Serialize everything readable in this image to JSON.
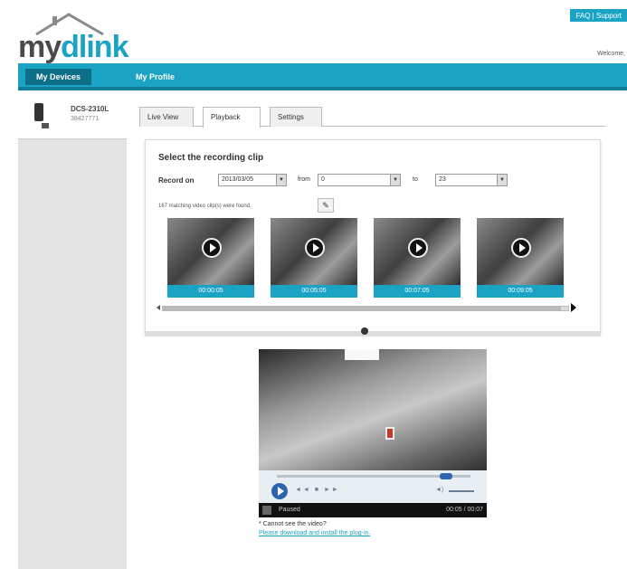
{
  "header": {
    "logo_my": "my",
    "logo_dlink": "dlink",
    "faq_label": "FAQ | Support",
    "welcome": "Welcome,"
  },
  "nav": {
    "devices_label": "My Devices",
    "profile_label": "My Profile"
  },
  "sidebar": {
    "device_name": "DCS-2310L",
    "device_sub": "38427771"
  },
  "tabs": [
    "Live View",
    "Playback",
    "Settings"
  ],
  "clip_panel": {
    "title": "Select the recording clip",
    "recorded_on_label": "Record on",
    "recorded_on_value": "2013/03/05",
    "from_label": "from",
    "from_value": "0",
    "to_label": "to",
    "to_value": "23",
    "matching_text": "167 matching video clip(s) were found.",
    "thumbnails": [
      {
        "time": "00:00:05"
      },
      {
        "time": "00:05:05"
      },
      {
        "time": "00:07:05"
      },
      {
        "time": "00:09:05"
      }
    ]
  },
  "player": {
    "controls_text": "◄◄  ■  ►►",
    "volume_text": "◄)",
    "status_text": "Paused",
    "time_text": "00:05 / 00:07"
  },
  "help": {
    "cannot_see": "* Cannot see the video?",
    "download": "Please download and install the plug-in."
  },
  "colors": {
    "accent": "#1aa3c4",
    "nav_active": "#0d6e87"
  }
}
